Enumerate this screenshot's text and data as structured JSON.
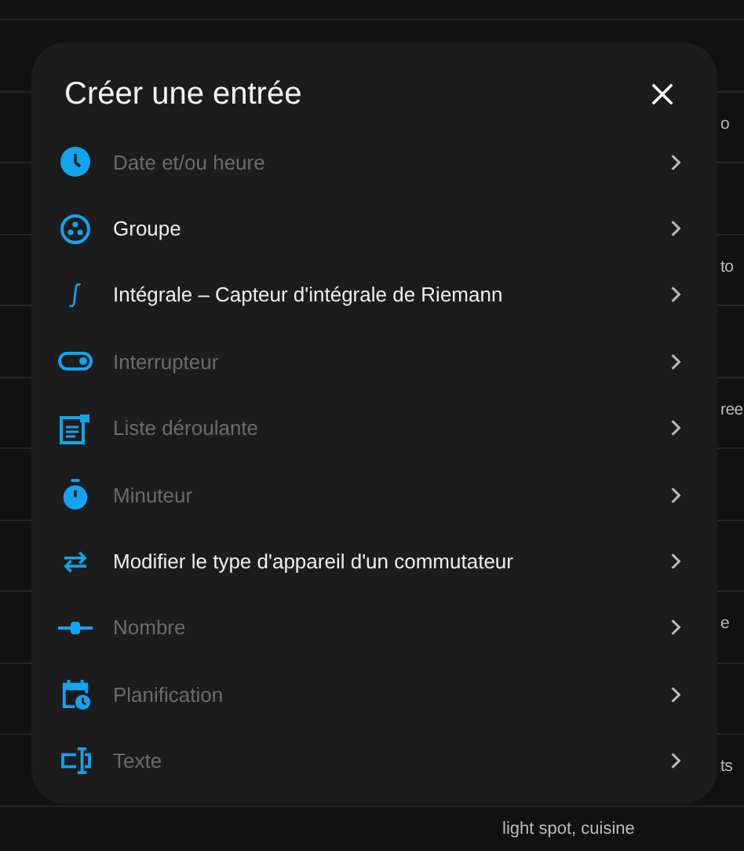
{
  "background": {
    "rows": [
      {},
      {
        "text": "o",
        "kind": "partial"
      },
      {},
      {
        "text": "to",
        "kind": "partial"
      },
      {},
      {
        "text": "ree",
        "kind": "partial"
      },
      {},
      {},
      {
        "text": "e",
        "kind": "partial"
      },
      {},
      {
        "text": "ts",
        "kind": "partial"
      },
      {
        "text": "light spot, cuisine",
        "kind": "full"
      }
    ]
  },
  "dialog": {
    "title": "Créer une entrée",
    "items": [
      {
        "label": "Date et/ou heure",
        "kind": "clock",
        "disabled": true
      },
      {
        "label": "Groupe",
        "kind": "group",
        "disabled": false
      },
      {
        "label": "Intégrale – Capteur d'intégrale de Riemann",
        "kind": "integral",
        "disabled": false
      },
      {
        "label": "Interrupteur",
        "kind": "toggle",
        "disabled": true
      },
      {
        "label": "Liste déroulante",
        "kind": "list",
        "disabled": true
      },
      {
        "label": "Minuteur",
        "kind": "timer",
        "disabled": true
      },
      {
        "label": "Modifier le type d'appareil d'un commutateur",
        "kind": "swap",
        "disabled": false
      },
      {
        "label": "Nombre",
        "kind": "slider",
        "disabled": true
      },
      {
        "label": "Planification",
        "kind": "calendar",
        "disabled": true
      },
      {
        "label": "Texte",
        "kind": "textfield",
        "disabled": true
      }
    ]
  }
}
